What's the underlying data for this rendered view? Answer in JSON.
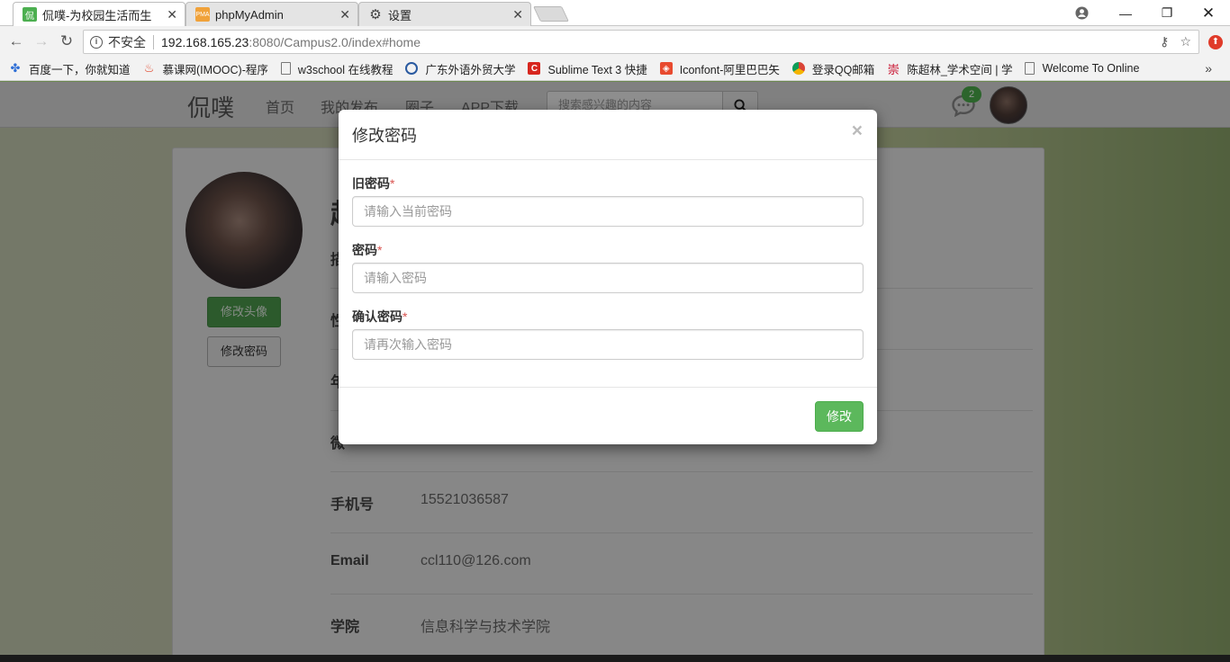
{
  "browser": {
    "tabs": [
      {
        "title": "侃噗-为校园生活而生",
        "favicon": "侃",
        "favicon_color": "#4caf50",
        "active": true
      },
      {
        "title": "phpMyAdmin",
        "favicon": "pma-icon",
        "active": false
      },
      {
        "title": "设置",
        "favicon": "gear-icon",
        "active": false
      }
    ],
    "address": {
      "security_label": "不安全",
      "host": "192.168.165.23",
      "rest": ":8080/Campus2.0/index#home"
    },
    "bookmarks": [
      {
        "label": "百度一下，你就知道",
        "icon": "baidu-paw-icon",
        "color": "#2f6fd6"
      },
      {
        "label": "慕课网(IMOOC)-程序",
        "icon": "flame-icon",
        "color": "#e0452a"
      },
      {
        "label": "w3school 在线教程",
        "icon": "page-icon",
        "color": "#888888"
      },
      {
        "label": "广东外语外贸大学",
        "icon": "seal-icon",
        "color": "#2a5aa0"
      },
      {
        "label": "Sublime Text 3 快捷",
        "icon": "c-logo-icon",
        "color": "#d7261e"
      },
      {
        "label": "Iconfont-阿里巴巴矢",
        "icon": "iconfont-icon",
        "color": "#e84a2f"
      },
      {
        "label": "登录QQ邮箱",
        "icon": "chrome-icon",
        "color": "#2c8e3c"
      },
      {
        "label": "陈超林_学术空间 | 学",
        "icon": "scholar-icon",
        "color": "#c8102e"
      },
      {
        "label": "Welcome To Online",
        "icon": "page-icon",
        "color": "#888888"
      }
    ]
  },
  "app": {
    "brand": "侃噗",
    "nav": [
      "首页",
      "我的发布",
      "圈子",
      "APP下载"
    ],
    "search_placeholder": "搜索感兴趣的内容",
    "message_count": "2"
  },
  "profile": {
    "name_initial": "赵",
    "change_avatar_label": "修改头像",
    "change_password_label": "修改密码",
    "rows": [
      {
        "label": "手机号",
        "value": "15521036587"
      },
      {
        "label": "Email",
        "value": "ccl110@126.com"
      },
      {
        "label": "学院",
        "value": "信息科学与技术学院"
      }
    ],
    "partial_labels": [
      "描",
      "性",
      "年",
      "微"
    ]
  },
  "modal": {
    "title": "修改密码",
    "close": "×",
    "fields": [
      {
        "label": "旧密码",
        "required": "*",
        "placeholder": "请输入当前密码"
      },
      {
        "label": "密码",
        "required": "*",
        "placeholder": "请输入密码"
      },
      {
        "label": "确认密码",
        "required": "*",
        "placeholder": "请再次输入密码"
      }
    ],
    "submit_label": "修改"
  },
  "colors": {
    "primary_green": "#5cb85c",
    "required_red": "#d9534f"
  }
}
